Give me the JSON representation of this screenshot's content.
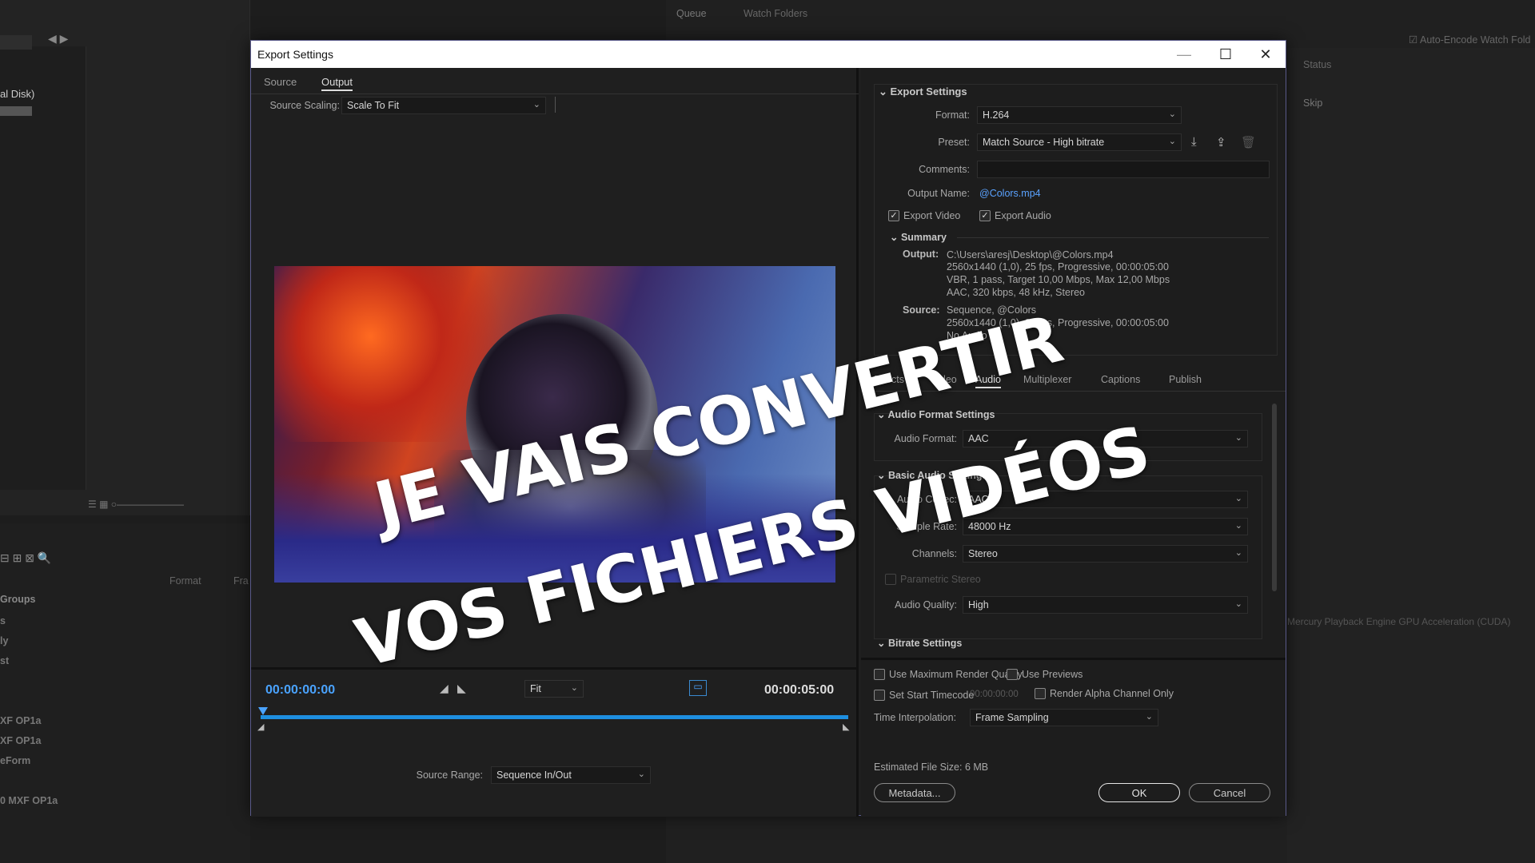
{
  "background": {
    "left_disk": "al Disk)",
    "queue_tab": "Queue",
    "watch_folders_tab": "Watch Folders",
    "auto_encode": "Auto-Encode Watch Fold",
    "status_col": "Status",
    "skip": "Skip",
    "format_col": "Format",
    "fr_col": "Fra",
    "groups": "Groups",
    "rows": [
      "s",
      "ly",
      "st",
      "XF OP1a",
      "XF OP1a",
      "eForm",
      "0 MXF OP1a"
    ],
    "mercury": "Mercury Playback Engine GPU Acceleration (CUDA)"
  },
  "dialog": {
    "title": "Export Settings",
    "left": {
      "tabs": [
        "Source",
        "Output"
      ],
      "source_scaling_label": "Source Scaling:",
      "source_scaling_value": "Scale To Fit",
      "timecode_start": "00:00:00:00",
      "timecode_end": "00:00:05:00",
      "zoom_value": "Fit",
      "source_range_label": "Source Range:",
      "source_range_value": "Sequence In/Out"
    },
    "right": {
      "export_settings_header": "Export Settings",
      "format_label": "Format:",
      "format_value": "H.264",
      "preset_label": "Preset:",
      "preset_value": "Match Source - High bitrate",
      "comments_label": "Comments:",
      "output_name_label": "Output Name:",
      "output_name_value": "@Colors.mp4",
      "export_video": "Export Video",
      "export_audio": "Export Audio",
      "summary_header": "Summary",
      "summary_output_label": "Output:",
      "summary_output_lines": [
        "C:\\Users\\aresj\\Desktop\\@Colors.mp4",
        "2560x1440 (1,0), 25 fps, Progressive, 00:00:05:00",
        "VBR, 1 pass, Target 10,00 Mbps, Max 12,00 Mbps",
        "AAC, 320 kbps, 48 kHz, Stereo"
      ],
      "summary_source_label": "Source:",
      "summary_source_lines": [
        "Sequence, @Colors",
        "2560x1440 (1,0), 25 fps, Progressive, 00:00:05:00",
        "No Audio"
      ],
      "tabs": [
        "Effects",
        "Video",
        "Audio",
        "Multiplexer",
        "Captions",
        "Publish"
      ],
      "active_tab": "Audio",
      "audio_format_header": "Audio Format Settings",
      "audio_format_label": "Audio Format:",
      "audio_format_value": "AAC",
      "basic_audio_header": "Basic Audio Settings",
      "audio_codec_label": "Audio Codec:",
      "audio_codec_value": "AAC",
      "sample_rate_label": "Sample Rate:",
      "sample_rate_value": "48000 Hz",
      "channels_label": "Channels:",
      "channels_value": "Stereo",
      "parametric_stereo": "Parametric Stereo",
      "audio_quality_label": "Audio Quality:",
      "audio_quality_value": "High",
      "bitrate_header": "Bitrate Settings",
      "use_max_render": "Use Maximum Render Quality",
      "use_previews": "Use Previews",
      "set_start_timecode": "Set Start Timecode",
      "start_timecode_value": "00:00:00:00",
      "render_alpha": "Render Alpha Channel Only",
      "time_interp_label": "Time Interpolation:",
      "time_interp_value": "Frame Sampling",
      "file_size_label": "Estimated File Size:",
      "file_size_value": "6 MB",
      "metadata_btn": "Metadata...",
      "ok_btn": "OK",
      "cancel_btn": "Cancel"
    }
  },
  "overlay": {
    "line1": "JE VAIS CONVERTIR",
    "line2": "VOS FICHIERS VIDÉOS"
  },
  "colors": {
    "accent": "#4aa3ff",
    "timeline": "#1e8fe0",
    "link": "#5aa2ff"
  }
}
